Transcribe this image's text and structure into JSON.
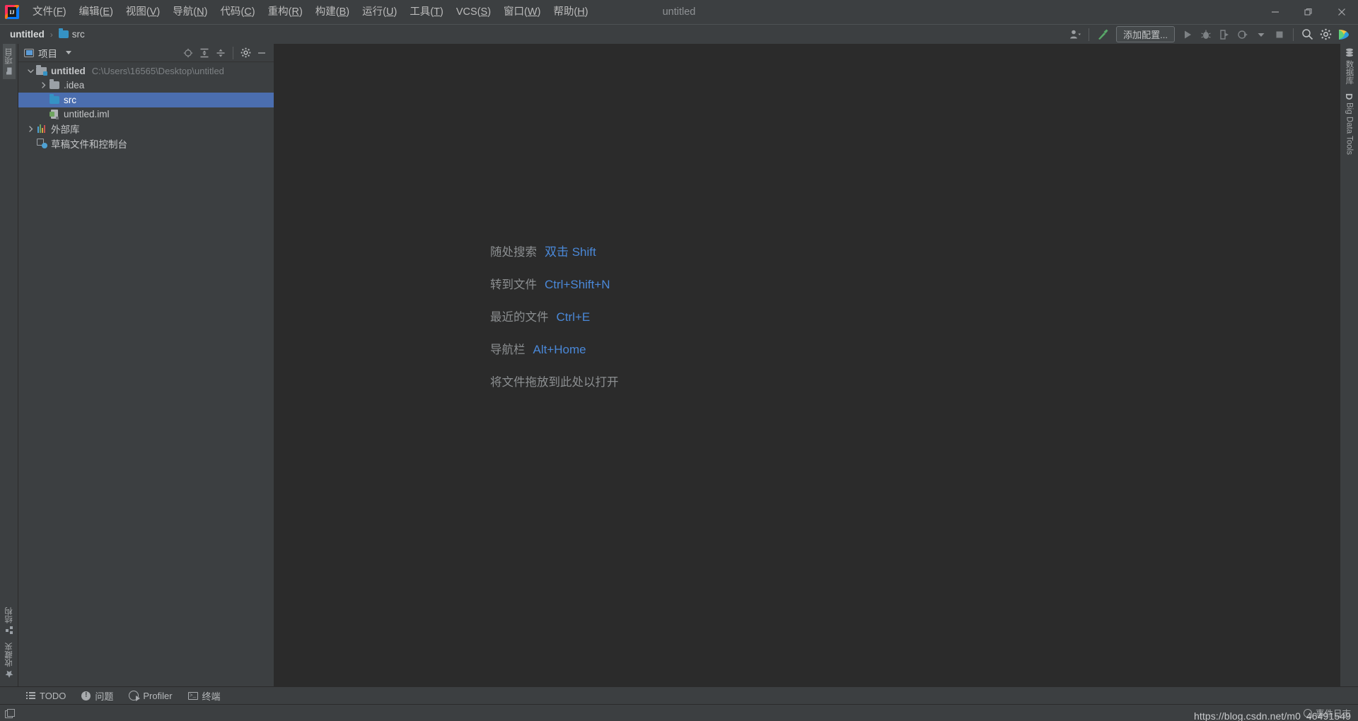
{
  "window": {
    "title": "untitled",
    "controls": [
      {
        "name": "minimize",
        "glyph": "—"
      },
      {
        "name": "restore",
        "glyph": "❐"
      },
      {
        "name": "close",
        "glyph": "✕"
      }
    ]
  },
  "menu": {
    "items": [
      {
        "label": "文件",
        "mnemonic": "F"
      },
      {
        "label": "编辑",
        "mnemonic": "E"
      },
      {
        "label": "视图",
        "mnemonic": "V"
      },
      {
        "label": "导航",
        "mnemonic": "N"
      },
      {
        "label": "代码",
        "mnemonic": "C"
      },
      {
        "label": "重构",
        "mnemonic": "R"
      },
      {
        "label": "构建",
        "mnemonic": "B"
      },
      {
        "label": "运行",
        "mnemonic": "U"
      },
      {
        "label": "工具",
        "mnemonic": "T"
      },
      {
        "label": "VCS",
        "mnemonic": "S"
      },
      {
        "label": "窗口",
        "mnemonic": "W"
      },
      {
        "label": "帮助",
        "mnemonic": "H"
      }
    ]
  },
  "navbar": {
    "breadcrumbs": [
      {
        "label": "untitled",
        "icon": "none"
      },
      {
        "label": "src",
        "icon": "folder-icon"
      }
    ],
    "separator": "›",
    "add_config_label": "添加配置...",
    "icons": [
      {
        "name": "user-account-icon"
      },
      {
        "name": "build-hammer-icon"
      },
      {
        "name": "run-icon"
      },
      {
        "name": "debug-icon"
      },
      {
        "name": "run-with-coverage-icon"
      },
      {
        "name": "profile-icon"
      },
      {
        "name": "stop-icon"
      },
      {
        "name": "search-everywhere-icon"
      },
      {
        "name": "settings-gear-icon"
      },
      {
        "name": "ide-assistant-icon"
      }
    ]
  },
  "left_strip": {
    "top": [
      {
        "label": "项目",
        "icon": "project-folder-icon",
        "active": true
      }
    ],
    "bottom": [
      {
        "label": "结构",
        "icon": "structure-icon",
        "active": false
      },
      {
        "label": "收藏夹",
        "icon": "star-icon",
        "active": false
      }
    ]
  },
  "right_strip": {
    "items": [
      {
        "label": "数据库",
        "icon": "database-icon"
      },
      {
        "label": "Big Data Tools",
        "icon": "big-data-tools-icon"
      }
    ]
  },
  "project_panel": {
    "title": "项目",
    "toolbar": [
      {
        "name": "select-opened-file-icon",
        "glyph": "⊕"
      },
      {
        "name": "expand-all-icon"
      },
      {
        "name": "collapse-all-icon"
      },
      {
        "name": "settings-gear-icon"
      },
      {
        "name": "hide-icon"
      }
    ],
    "tree": [
      {
        "label": "untitled",
        "path": "C:\\Users\\16565\\Desktop\\untitled",
        "icon": "module-icon",
        "arrow": "expanded",
        "depth": 0,
        "bold": true,
        "selected": false
      },
      {
        "label": ".idea",
        "path": "",
        "icon": "folder-grey-icon",
        "arrow": "collapsed",
        "depth": 1,
        "bold": false,
        "selected": false
      },
      {
        "label": "src",
        "path": "",
        "icon": "folder-blue-icon",
        "arrow": "none",
        "depth": 1,
        "bold": false,
        "selected": true
      },
      {
        "label": "untitled.iml",
        "path": "",
        "icon": "iml-file-icon",
        "arrow": "none",
        "depth": 1,
        "bold": false,
        "selected": false
      },
      {
        "label": "外部库",
        "path": "",
        "icon": "library-icon",
        "arrow": "collapsed",
        "depth": 0,
        "bold": false,
        "selected": false
      },
      {
        "label": "草稿文件和控制台",
        "path": "",
        "icon": "scratches-icon",
        "arrow": "none",
        "depth": 0,
        "bold": false,
        "selected": false
      }
    ]
  },
  "editor": {
    "hints": [
      {
        "label": "随处搜索",
        "key": "双击 Shift"
      },
      {
        "label": "转到文件",
        "key": "Ctrl+Shift+N"
      },
      {
        "label": "最近的文件",
        "key": "Ctrl+E"
      },
      {
        "label": "导航栏",
        "key": "Alt+Home"
      },
      {
        "label": "将文件拖放到此处以打开",
        "key": ""
      }
    ]
  },
  "bottom_bar": {
    "items": [
      {
        "label": "TODO",
        "icon": "todo-list-icon"
      },
      {
        "label": "问题",
        "icon": "problems-icon"
      },
      {
        "label": "Profiler",
        "icon": "profiler-icon"
      },
      {
        "label": "终端",
        "icon": "terminal-icon"
      }
    ]
  },
  "status_bar": {
    "toggle_icon": "toggle-toolwindows-icon",
    "event_log": "事件日志",
    "watermark": "https://blog.csdn.net/m0_46491549"
  },
  "colors": {
    "chrome": "#3c3f41",
    "editor_bg": "#2b2b2b",
    "selection": "#4b6eaf",
    "accent_blue": "#4a88d8",
    "folder_blue": "#3592c4",
    "text": "#c3c5c7",
    "muted": "#8c8f91"
  }
}
